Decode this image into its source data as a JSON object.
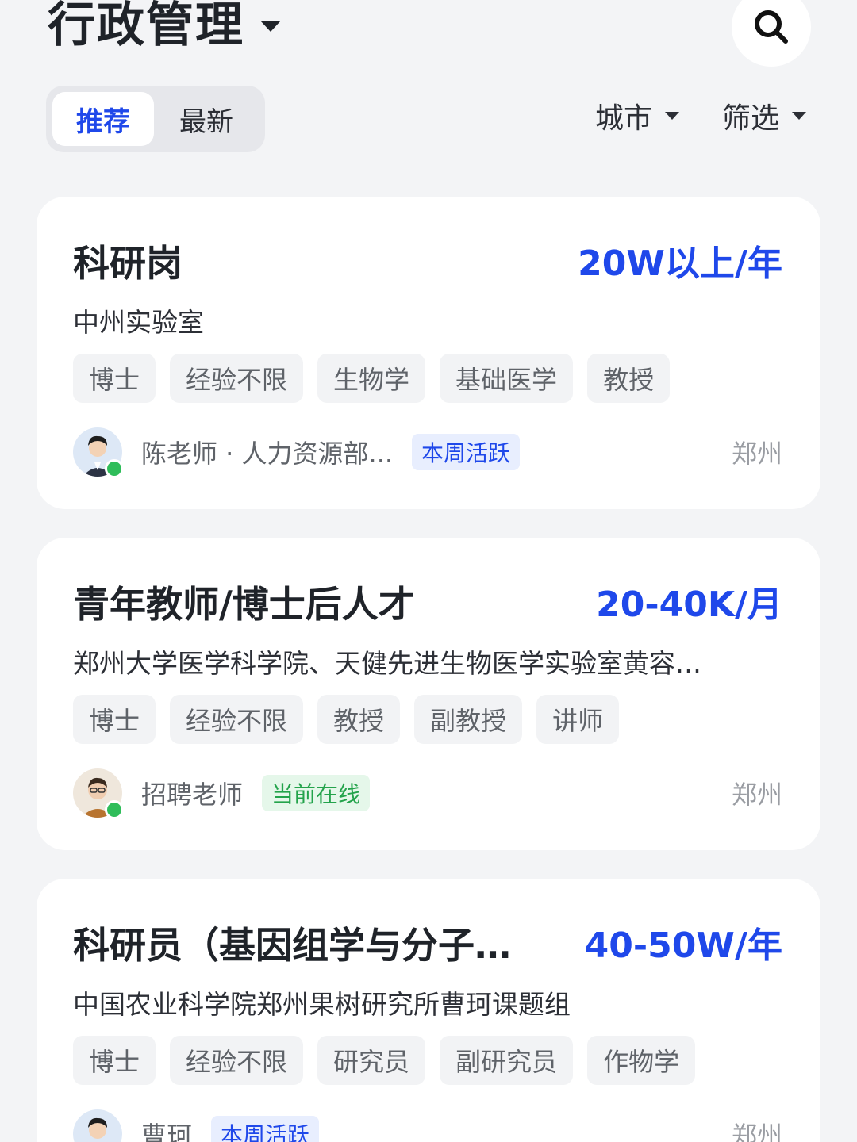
{
  "header": {
    "title": "行政管理",
    "tabs": [
      {
        "label": "推荐",
        "active": true
      },
      {
        "label": "最新",
        "active": false
      }
    ],
    "filters": {
      "city": "城市",
      "filter": "筛选"
    }
  },
  "colors": {
    "accent": "#1f48ea",
    "online": "#2fbd5a",
    "background": "#f3f4f6"
  },
  "jobs": [
    {
      "title": "科研岗",
      "salary": "20W以上/年",
      "company": "中州实验室",
      "tags": [
        "博士",
        "经验不限",
        "生物学",
        "基础医学",
        "教授"
      ],
      "recruiter": "陈老师 · 人力资源部...",
      "badge": "本周活跃",
      "city": "郑州"
    },
    {
      "title": "青年教师/博士后人才",
      "salary": "20-40K/月",
      "company": "郑州大学医学科学院、天健先进生物医学实验室黄容…",
      "tags": [
        "博士",
        "经验不限",
        "教授",
        "副教授",
        "讲师"
      ],
      "recruiter": "招聘老师",
      "badge": "当前在线",
      "city": "郑州"
    },
    {
      "title": "科研员（基因组学与分子…",
      "salary": "40-50W/年",
      "company": "中国农业科学院郑州果树研究所曹珂课题组",
      "tags": [
        "博士",
        "经验不限",
        "研究员",
        "副研究员",
        "作物学"
      ],
      "recruiter": "曹珂",
      "badge": "本周活跃",
      "city": "郑州"
    }
  ]
}
